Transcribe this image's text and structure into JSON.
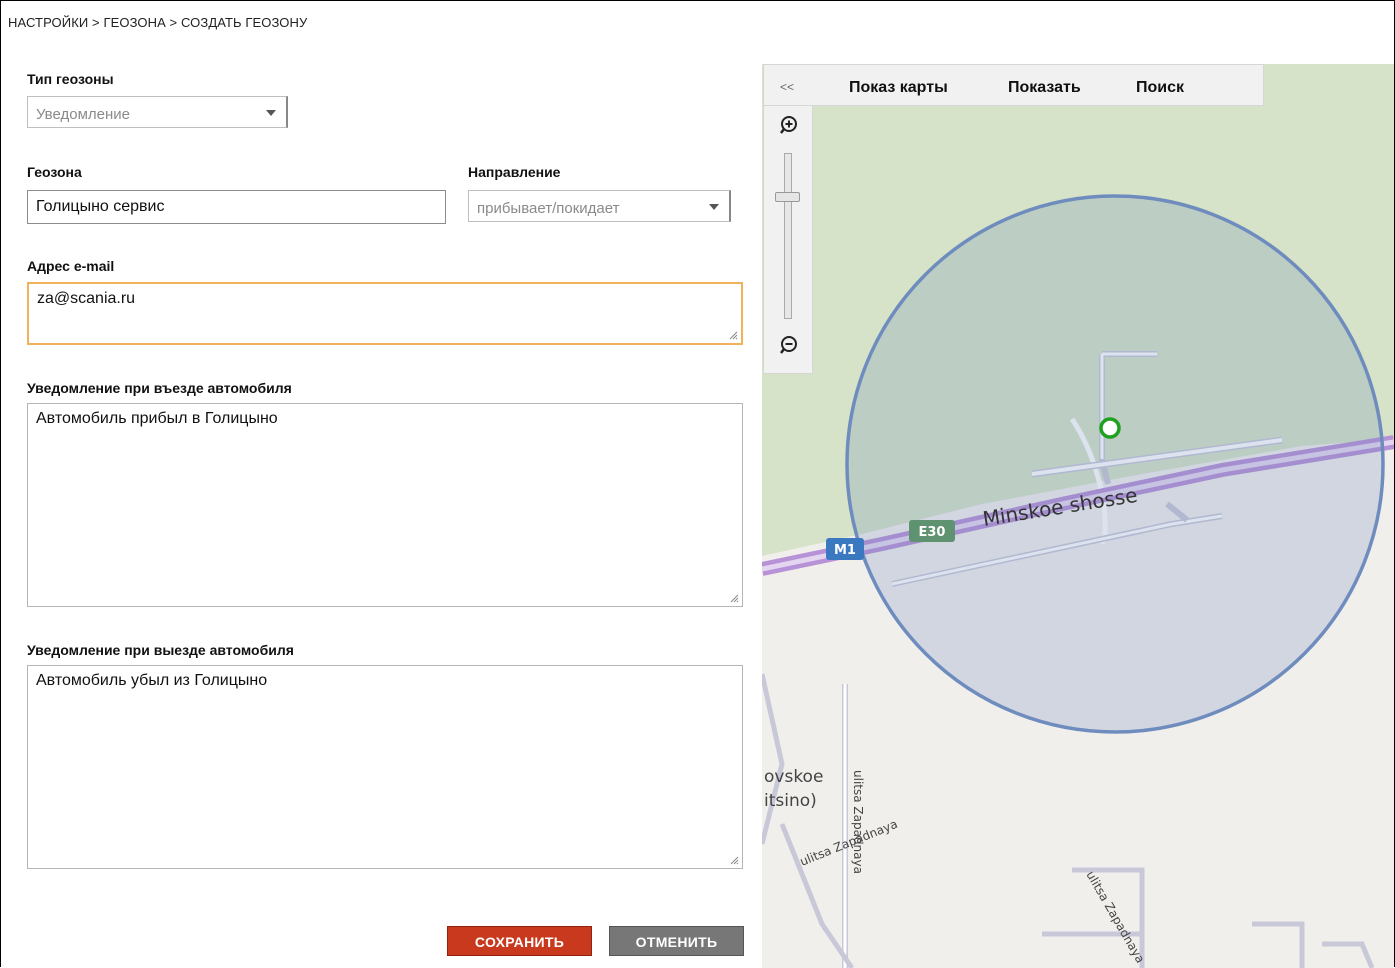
{
  "breadcrumb": "НАСТРОЙКИ > ГЕОЗОНА > СОЗДАТЬ ГЕОЗОНУ",
  "geozone_type": {
    "label": "Тип геозоны",
    "value": "Уведомление"
  },
  "geozone": {
    "label": "Геозона",
    "value": "Голицыно сервис"
  },
  "direction": {
    "label": "Направление",
    "value": "прибывает/покидает"
  },
  "email": {
    "label": "Адрес e-mail",
    "value": "za@scania.ru"
  },
  "entry_notice": {
    "label": "Уведомление при въезде автомобиля",
    "value": "Автомобиль прибыл в Голицыно"
  },
  "exit_notice": {
    "label": "Уведомление при выезде автомобиля",
    "value": "Автомобиль убыл из Голицыно"
  },
  "buttons": {
    "save": "СОХРАНИТЬ",
    "cancel": "ОТМЕНИТЬ"
  },
  "map": {
    "collapse": "<<",
    "tabs": [
      "Показ карты",
      "Показать",
      "Поиск"
    ],
    "road_label": "Minskoe shosse",
    "shield_m1": "M1",
    "shield_e30": "E30",
    "place_line1": "ovskoe",
    "place_line2": "itsino)",
    "street_1": "ulitsa Zapadnaya",
    "street_2": "ulitsa Zapadnaya",
    "street_3": "ulitsa Zapadnaya",
    "colors": {
      "geofence_stroke": "#6f8cbe",
      "green_area": "#d6e3c8",
      "road": "#b892d6",
      "marker": "#1fa01f"
    }
  }
}
